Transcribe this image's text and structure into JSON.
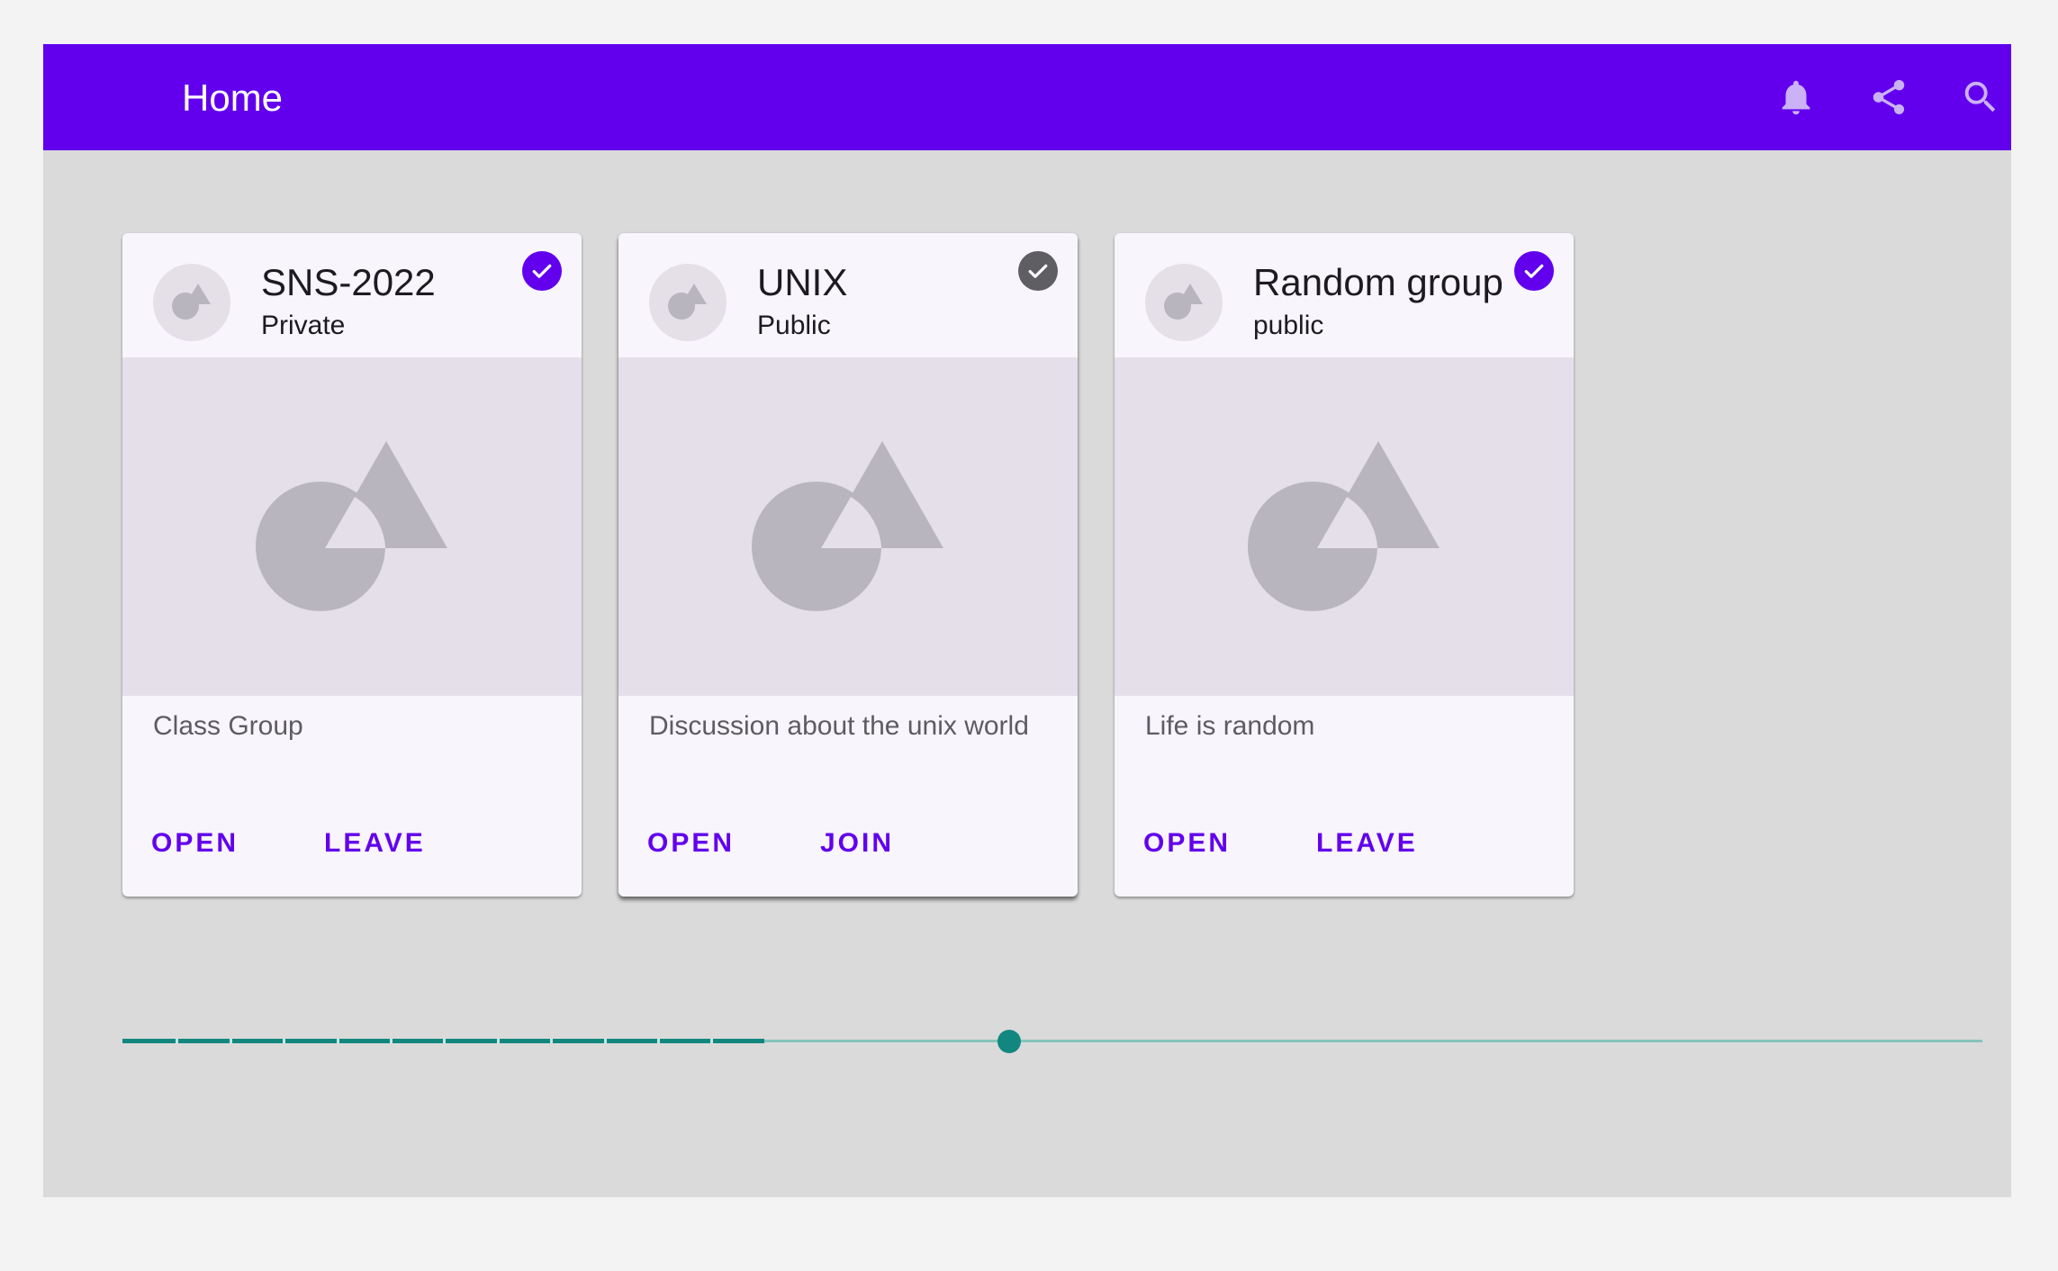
{
  "appbar": {
    "title": "Home",
    "background": "#6200ee",
    "actions": [
      {
        "icon": "bell-icon"
      },
      {
        "icon": "share-icon"
      },
      {
        "icon": "search-icon"
      }
    ]
  },
  "cards": [
    {
      "title": "SNS-2022",
      "subtitle": "Private",
      "description": "Class Group",
      "checked_color": "#6200ee",
      "primary_action": "OPEN",
      "secondary_action": "LEAVE"
    },
    {
      "title": "UNIX",
      "subtitle": "Public",
      "description": "Discussion about the unix world",
      "checked_color": "#5f5f63",
      "primary_action": "OPEN",
      "secondary_action": "JOIN"
    },
    {
      "title": "Random group",
      "subtitle": "public",
      "description": "Life is random",
      "checked_color": "#6200ee",
      "primary_action": "OPEN",
      "secondary_action": "LEAVE"
    }
  ],
  "slider": {
    "value_fraction": 0.477,
    "fill_fraction": 0.345,
    "tick_count": 12,
    "active_color": "#11877f",
    "inactive_color": "#86c4bd"
  }
}
